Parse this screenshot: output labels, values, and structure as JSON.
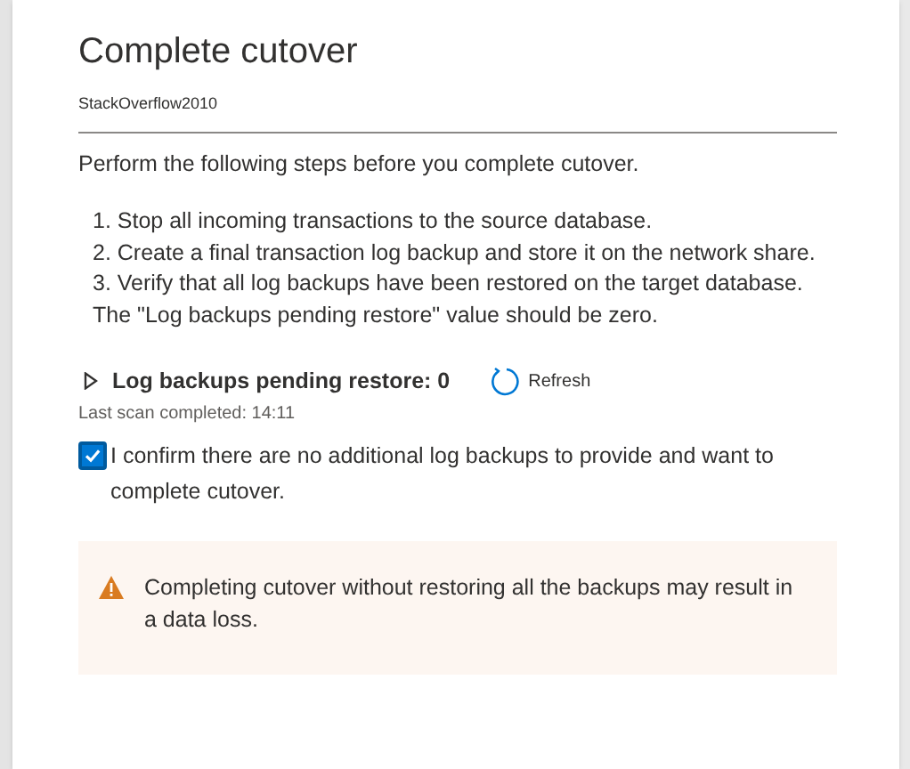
{
  "dialog": {
    "title": "Complete cutover",
    "subtitle": "StackOverflow2010"
  },
  "intro": "Perform the following steps before you complete cutover.",
  "steps": [
    "1. Stop all incoming transactions to the source database.",
    "2. Create a final transaction log backup and store it on the network share.",
    "3. Verify that all log backups have been restored on the target database."
  ],
  "steps_note": "The \"Log backups pending restore\" value should be zero.",
  "pending": {
    "label": "Log backups pending restore: 0",
    "expanded": false,
    "refresh": "Refresh",
    "last_scan": "Last scan completed: 14:11"
  },
  "confirm": {
    "label": "I confirm there are no additional log backups to provide and want to complete cutover.",
    "checked": true
  },
  "warning": {
    "text": "Completing cutover without restoring all the backups may result in a data loss."
  }
}
